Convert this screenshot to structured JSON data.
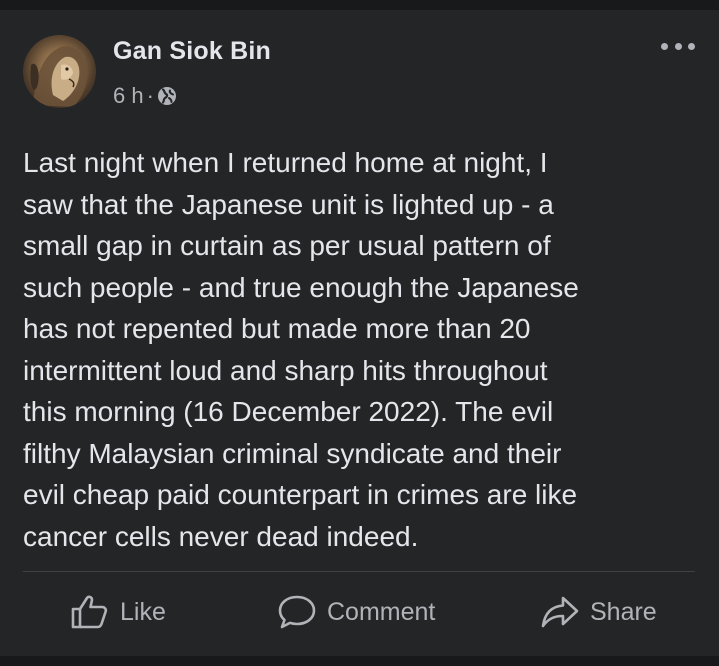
{
  "post": {
    "author": "Gan Siok Bin",
    "time": "6 h",
    "separator": "·",
    "privacy_icon": "globe-icon",
    "more_icon": "more-horizontal-icon",
    "text": "Last night when I returned home at night, I\nsaw that the Japanese unit is lighted up - a\nsmall gap in curtain as per usual pattern of\nsuch people - and true enough the Japanese\nhas not repented but made more than 20\nintermittent loud and sharp hits throughout\nthis morning (16 December 2022). The evil\nfilthy Malaysian criminal syndicate and their\nevil cheap paid counterpart in crimes are like\ncancer cells never dead indeed."
  },
  "actions": {
    "like_label": "Like",
    "comment_label": "Comment",
    "share_label": "Share"
  },
  "colors": {
    "background": "#18191a",
    "card": "#242526",
    "primary_text": "#e4e6eb",
    "secondary_text": "#b0b3b8"
  }
}
